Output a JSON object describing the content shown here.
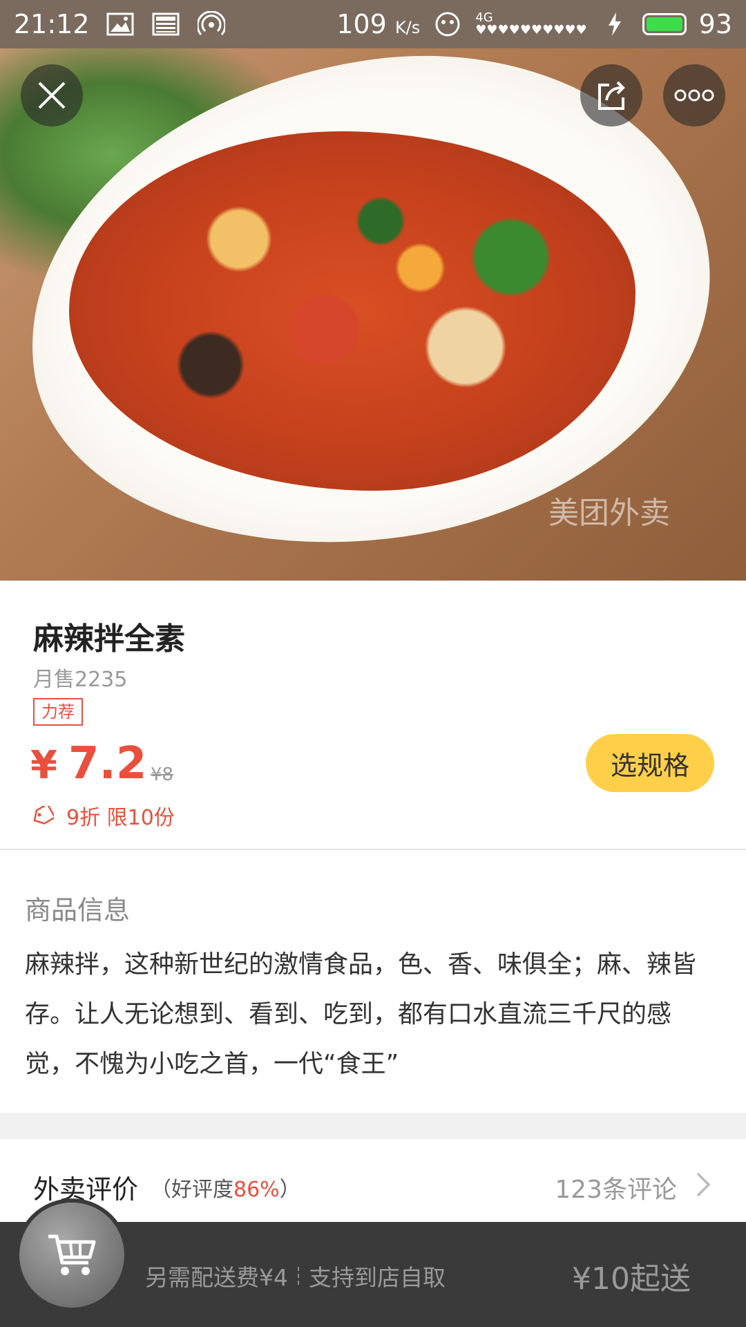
{
  "status_bar": {
    "time": "21:12",
    "net_speed": "109",
    "net_unit": "K/s",
    "signal_label": "4G",
    "battery": "93",
    "battery_level": 0.93,
    "icons": [
      "image-icon",
      "news-icon",
      "hotspot-icon",
      "app-icon",
      "signal-icon",
      "charging-icon",
      "battery-icon"
    ]
  },
  "hero": {
    "watermark": "美团外卖",
    "buttons": [
      "close-icon",
      "share-icon",
      "more-icon"
    ]
  },
  "product": {
    "title": "麻辣拌全素",
    "monthly_sales": "月售2235",
    "badge": "力荐",
    "price_symbol": "¥",
    "price": "7.2",
    "original_price": "¥8",
    "discount_text": "9折 限10份",
    "spec_button": "选规格"
  },
  "description": {
    "heading": "商品信息",
    "text": "麻辣拌，这种新世纪的激情食品，色、香、味俱全；麻、辣皆存。让人无论想到、看到、吃到，都有口水直流三千尺的感觉，不愧为小吃之首，一代“食王”"
  },
  "reviews": {
    "title": "外卖评价",
    "rating_prefix": "（好评度",
    "rating_pct": "86%",
    "rating_suffix": "）",
    "count": "123条评论"
  },
  "bottom_bar": {
    "delivery_fee": "另需配送费¥4",
    "pickup": "支持到店自取",
    "min_order": "¥10起送"
  },
  "colors": {
    "accent": "#e8503d",
    "button": "#ffcf4a",
    "bottom_bar": "#3a3a3a"
  }
}
